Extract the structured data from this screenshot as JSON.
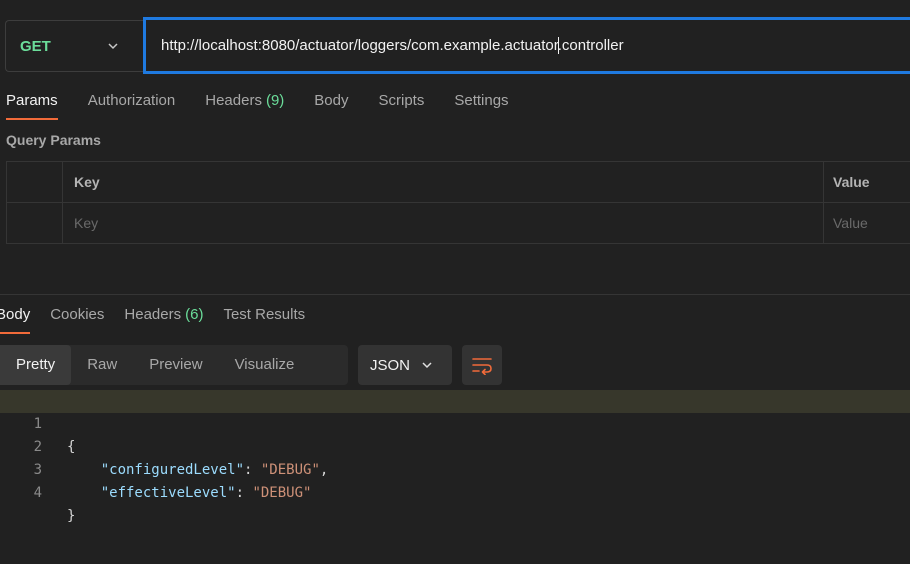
{
  "request": {
    "method": "GET",
    "url_before_cursor": "http://localhost:8080/actuator/loggers/com.example.actuator",
    "url_after_cursor": ".controller"
  },
  "request_tabs": [
    {
      "label": "Params",
      "active": true
    },
    {
      "label": "Authorization"
    },
    {
      "label": "Headers",
      "count": "(9)"
    },
    {
      "label": "Body"
    },
    {
      "label": "Scripts"
    },
    {
      "label": "Settings"
    }
  ],
  "query_params": {
    "title": "Query Params",
    "headers": {
      "key": "Key",
      "value": "Value"
    },
    "placeholders": {
      "key": "Key",
      "value": "Value"
    }
  },
  "response_tabs": [
    {
      "label": "Body",
      "active": true
    },
    {
      "label": "Cookies"
    },
    {
      "label": "Headers",
      "count": "(6)"
    },
    {
      "label": "Test Results"
    }
  ],
  "view_modes": [
    "Pretty",
    "Raw",
    "Preview",
    "Visualize"
  ],
  "active_view": "Pretty",
  "format": "JSON",
  "code_lines": [
    {
      "n": "1",
      "text": "{"
    },
    {
      "n": "2",
      "key": "\"configuredLevel\"",
      "sep": ": ",
      "val": "\"DEBUG\"",
      "tail": ","
    },
    {
      "n": "3",
      "key": "\"effectiveLevel\"",
      "sep": ": ",
      "val": "\"DEBUG\"",
      "tail": ""
    },
    {
      "n": "4",
      "text": "}"
    }
  ],
  "colors": {
    "accent_tab": "#f26b3a",
    "url_focus": "#1f7ae0",
    "method_get": "#6bdd9a"
  }
}
